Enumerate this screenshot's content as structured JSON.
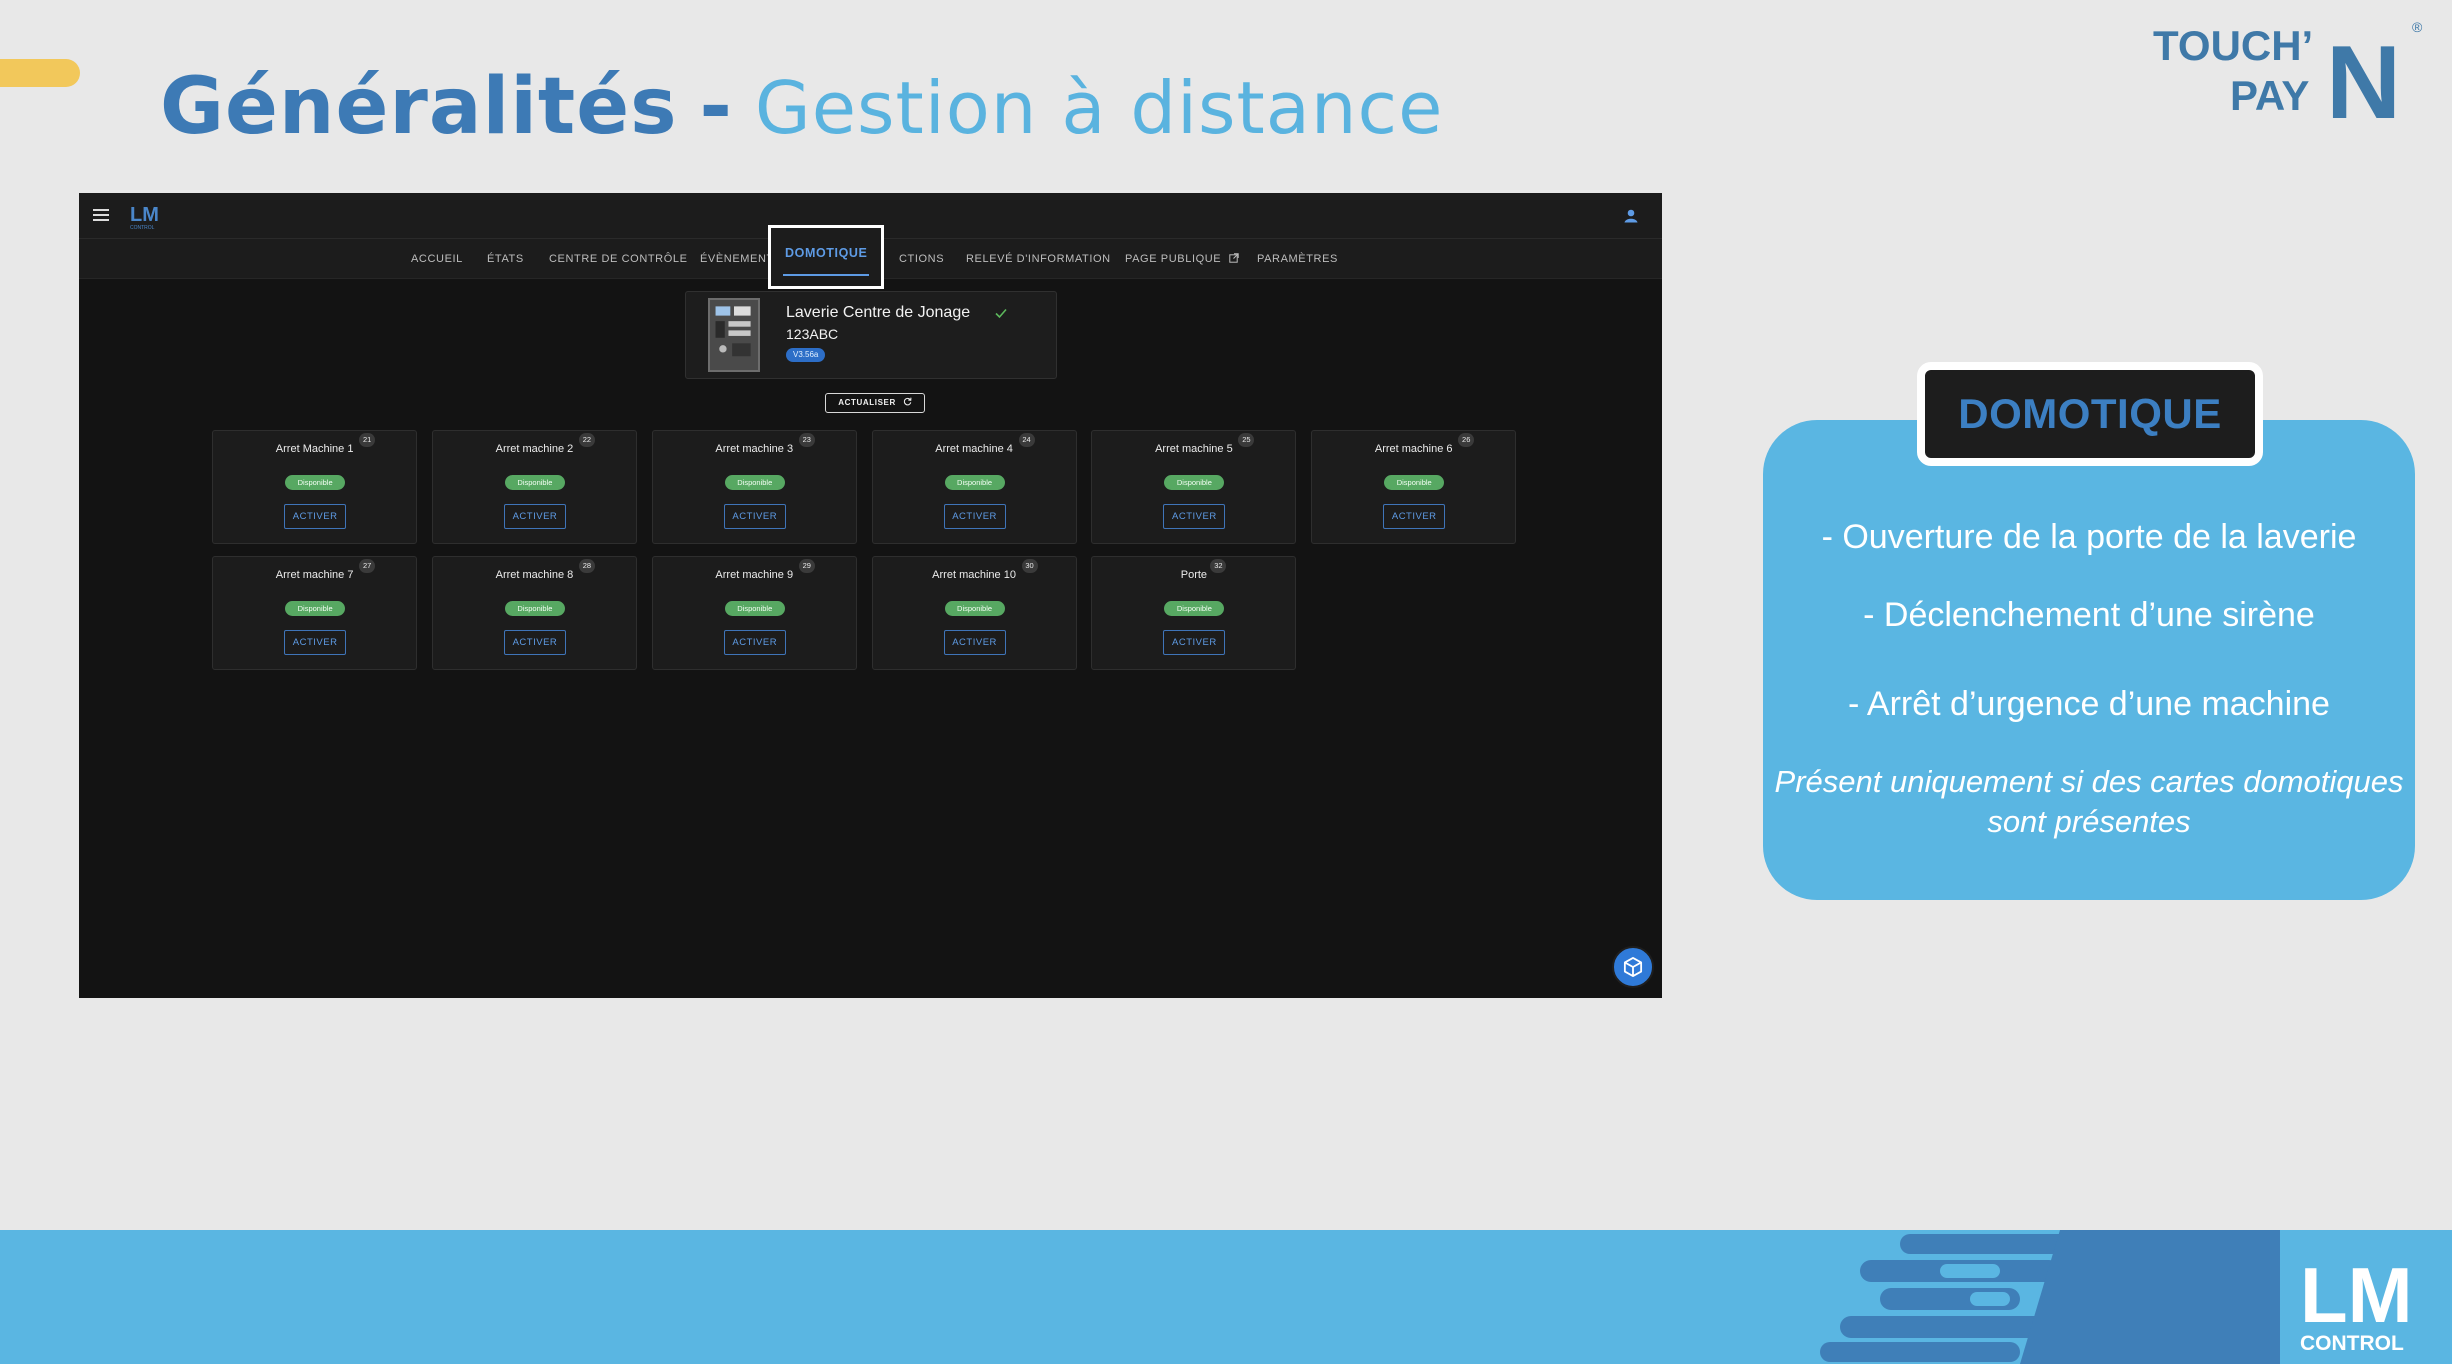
{
  "slide": {
    "title_main": "Généralités",
    "title_sep": "-",
    "title_sub": "Gestion à distance"
  },
  "brand": {
    "line1": "TOUCH’",
    "line2": "PAY",
    "big_letter": "N",
    "registered": "®"
  },
  "app": {
    "logo_text": "LM",
    "logo_sub": "CONTROL",
    "nav": [
      {
        "label": "ACCUEIL"
      },
      {
        "label": "ÉTATS"
      },
      {
        "label": "CENTRE DE CONTRÔLE"
      },
      {
        "label": "ÉVÈNEMENT"
      },
      {
        "label": "DOMOTIQUE"
      },
      {
        "label": "CTIONS"
      },
      {
        "label": "RELEVÉ D'INFORMATION"
      },
      {
        "label": "PAGE PUBLIQUE"
      },
      {
        "label": "PARAMÈTRES"
      }
    ],
    "site": {
      "name": "Laverie Centre de Jonage",
      "code": "123ABC",
      "version": "V3.56a"
    },
    "refresh_label": "ACTUALISER",
    "tiles": [
      {
        "name": "Arret Machine 1",
        "id": "21",
        "status": "Disponible",
        "action": "ACTIVER"
      },
      {
        "name": "Arret machine 2",
        "id": "22",
        "status": "Disponible",
        "action": "ACTIVER"
      },
      {
        "name": "Arret machine 3",
        "id": "23",
        "status": "Disponible",
        "action": "ACTIVER"
      },
      {
        "name": "Arret machine 4",
        "id": "24",
        "status": "Disponible",
        "action": "ACTIVER"
      },
      {
        "name": "Arret machine 5",
        "id": "25",
        "status": "Disponible",
        "action": "ACTIVER"
      },
      {
        "name": "Arret machine 6",
        "id": "26",
        "status": "Disponible",
        "action": "ACTIVER"
      },
      {
        "name": "Arret machine 7",
        "id": "27",
        "status": "Disponible",
        "action": "ACTIVER"
      },
      {
        "name": "Arret machine 8",
        "id": "28",
        "status": "Disponible",
        "action": "ACTIVER"
      },
      {
        "name": "Arret machine 9",
        "id": "29",
        "status": "Disponible",
        "action": "ACTIVER"
      },
      {
        "name": "Arret machine 10",
        "id": "30",
        "status": "Disponible",
        "action": "ACTIVER"
      },
      {
        "name": "Porte",
        "id": "32",
        "status": "Disponible",
        "action": "ACTIVER"
      }
    ]
  },
  "panel": {
    "title": "DOMOTIQUE",
    "items": [
      "- Ouverture de la porte de la laverie",
      "- Déclenchement d’une sirène",
      "- Arrêt d’urgence d’une machine"
    ],
    "note": "Présent uniquement si des cartes domotiques sont présentes"
  },
  "footer": {
    "logo_text": "LM",
    "logo_sub": "CONTROL"
  },
  "colors": {
    "title_dark_blue": "#3d7ab5",
    "title_light_blue": "#5ab3df",
    "panel_blue": "#5ab6e2",
    "accent_yellow": "#f2c85b",
    "status_green": "#57a862",
    "link_blue": "#5e9be5"
  }
}
